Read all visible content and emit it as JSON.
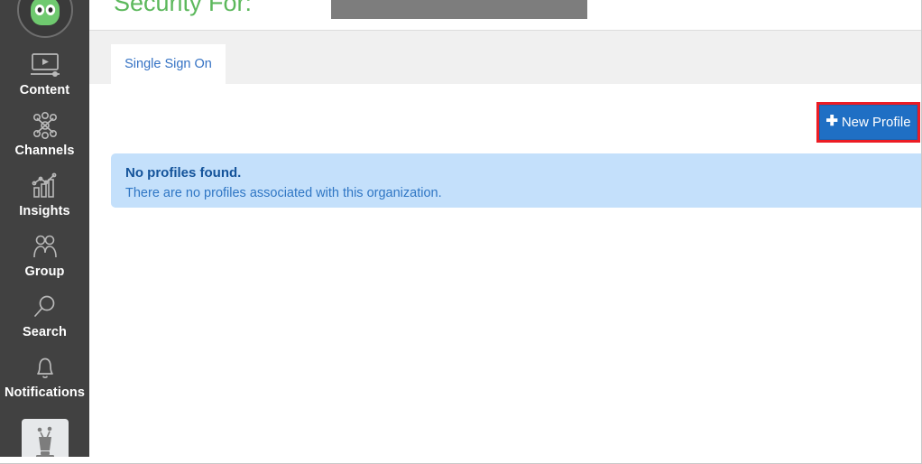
{
  "sidebar": {
    "logo": {
      "icon": "alien-robot-head-logo",
      "accent": "#6fc96f"
    },
    "items": [
      {
        "label": "Content",
        "icon": "video-screen-icon"
      },
      {
        "label": "Channels",
        "icon": "network-nodes-icon"
      },
      {
        "label": "Insights",
        "icon": "bar-chart-trend-icon"
      },
      {
        "label": "Group",
        "icon": "two-people-icon"
      },
      {
        "label": "Search",
        "icon": "magnifier-icon"
      },
      {
        "label": "Notifications",
        "icon": "bell-icon"
      }
    ],
    "avatar": {
      "icon": "robot-avatar-icon",
      "alt": "User avatar"
    },
    "background": "#414141"
  },
  "header": {
    "title": "Security For:",
    "title_color": "#5cb85c",
    "redaction": {
      "label": "",
      "color": "#7d7d7d"
    }
  },
  "tabs": [
    {
      "label": "Single Sign On",
      "active": true
    }
  ],
  "toolbar": {
    "new_profile_label": "New Profile",
    "plus_icon": "✚",
    "button_color": "#1f6fc4",
    "highlight_color": "#ec1c24"
  },
  "alert": {
    "title": "No profiles found.",
    "body": "There are no profiles associated with this organization.",
    "background": "#c4e0fb",
    "title_color": "#14539a",
    "body_color": "#2f76c4"
  }
}
